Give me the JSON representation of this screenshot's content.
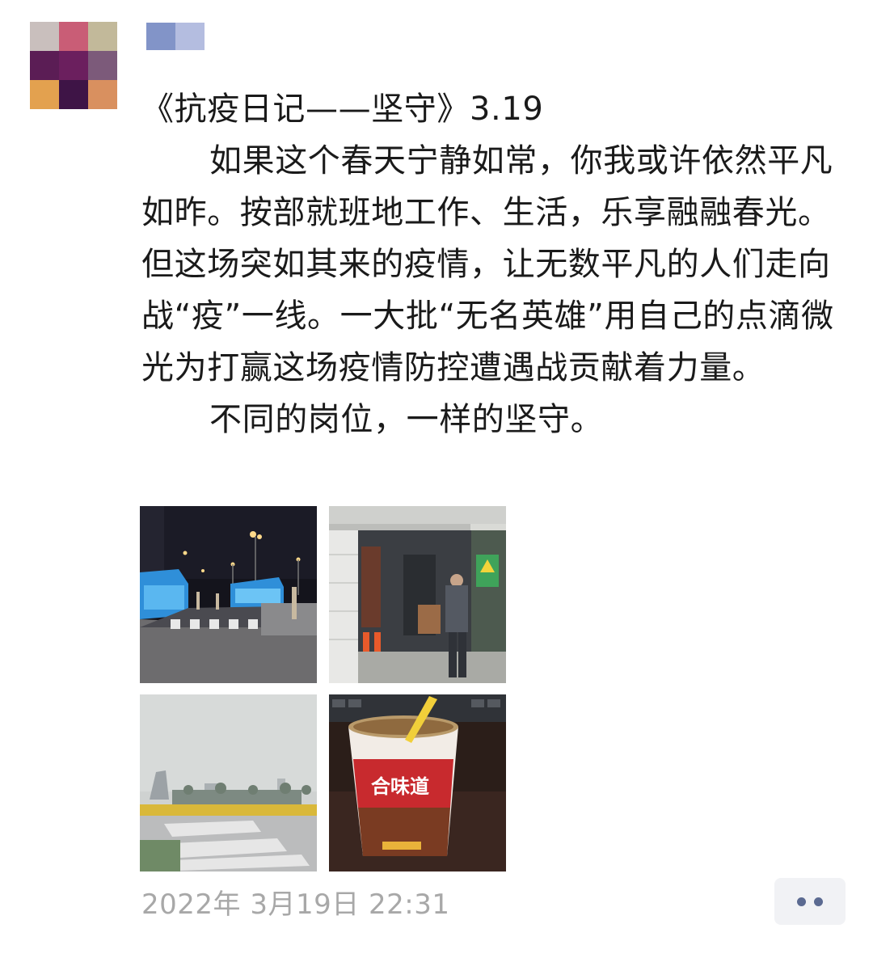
{
  "post": {
    "title_line": "《抗疫日记——坚守》3.19",
    "paragraph1": "如果这个春天宁静如常，你我或许依然平凡如昨。按部就班地工作、生活，乐享融融春光。但这场突如其来的疫情，让无数平凡的人们走向战“疫”一线。一大批“无名英雄”用自己的点滴微光为打赢这场疫情防控遭遇战贡献着力量。",
    "paragraph2": "不同的岗位，一样的坚守。",
    "timestamp": "2022年 3月19日 22:31"
  },
  "photos": [
    {
      "id": "night-street-checkpoint"
    },
    {
      "id": "entrance-with-worker"
    },
    {
      "id": "foggy-plaza"
    },
    {
      "id": "instant-noodle-cup",
      "brand_text": "合味道"
    }
  ],
  "colors": {
    "text": "#1a1a1a",
    "timestamp": "#a8a8a8",
    "more_button_bg": "#f1f2f5",
    "more_button_dots": "#5b6a91"
  },
  "icons": {
    "more": "more-dots-icon"
  }
}
